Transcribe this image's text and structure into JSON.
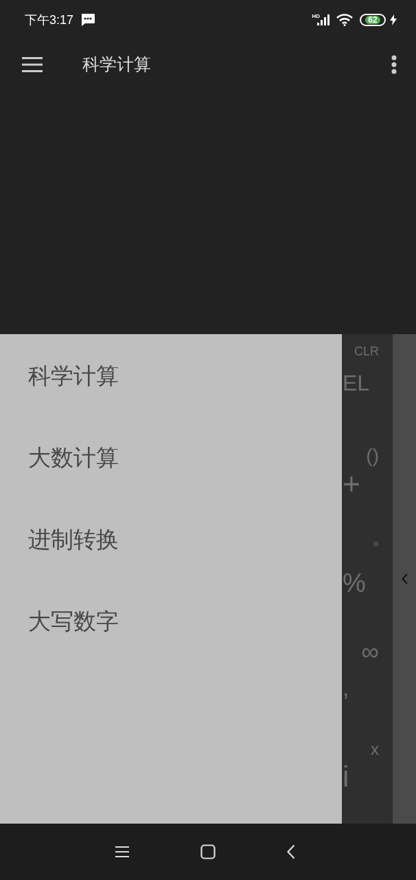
{
  "status_bar": {
    "time": "下午3:17",
    "network_label": "HD",
    "battery": "62"
  },
  "toolbar": {
    "title": "科学计算"
  },
  "drawer": {
    "items": [
      {
        "label": "科学计算"
      },
      {
        "label": "大数计算"
      },
      {
        "label": "进制转换"
      },
      {
        "label": "大写数字"
      }
    ]
  },
  "keypad": {
    "keys": [
      {
        "label": "CLR",
        "kind": "right"
      },
      {
        "label": "EL",
        "kind": "left"
      },
      {
        "label": "()",
        "kind": "right"
      },
      {
        "label": "+",
        "kind": "left"
      },
      {
        "label": "°",
        "kind": "right"
      },
      {
        "label": "%",
        "kind": "left"
      },
      {
        "label": "∞",
        "kind": "right"
      },
      {
        "label": ",",
        "kind": "left"
      },
      {
        "label": "x",
        "kind": "right"
      },
      {
        "label": "i",
        "kind": "left"
      }
    ]
  }
}
